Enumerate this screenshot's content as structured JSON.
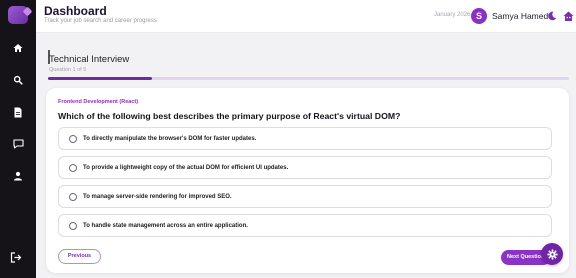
{
  "header": {
    "title": "Dashboard",
    "subtitle": "Track your job search and career progress",
    "date": "January 2026",
    "avatar_initial": "S",
    "username": "Samya Hamed"
  },
  "sidebar": {
    "items": [
      {
        "icon": "home-icon"
      },
      {
        "icon": "search-icon"
      },
      {
        "icon": "document-icon"
      },
      {
        "icon": "message-icon"
      },
      {
        "icon": "user-icon"
      }
    ],
    "logout_icon": "logout-icon"
  },
  "interview": {
    "title": "Technical Interview",
    "question_count": "Question 1 of 5",
    "progress": 0.2
  },
  "question": {
    "category": "Frontend Development (React)",
    "text": "Which of the following best describes the primary purpose of React's virtual DOM?",
    "options": [
      "To directly manipulate the browser's DOM for faster updates.",
      "To provide a lightweight copy of the actual DOM for efficient UI updates.",
      "To manage server-side rendering for improved SEO.",
      "To handle state management across an entire application."
    ]
  },
  "buttons": {
    "previous": "Previous",
    "next": "Next Question"
  },
  "colors": {
    "accent": "#8a33c7",
    "sidebar_bg": "#151318",
    "progress_fill": "#6e2aa3"
  }
}
